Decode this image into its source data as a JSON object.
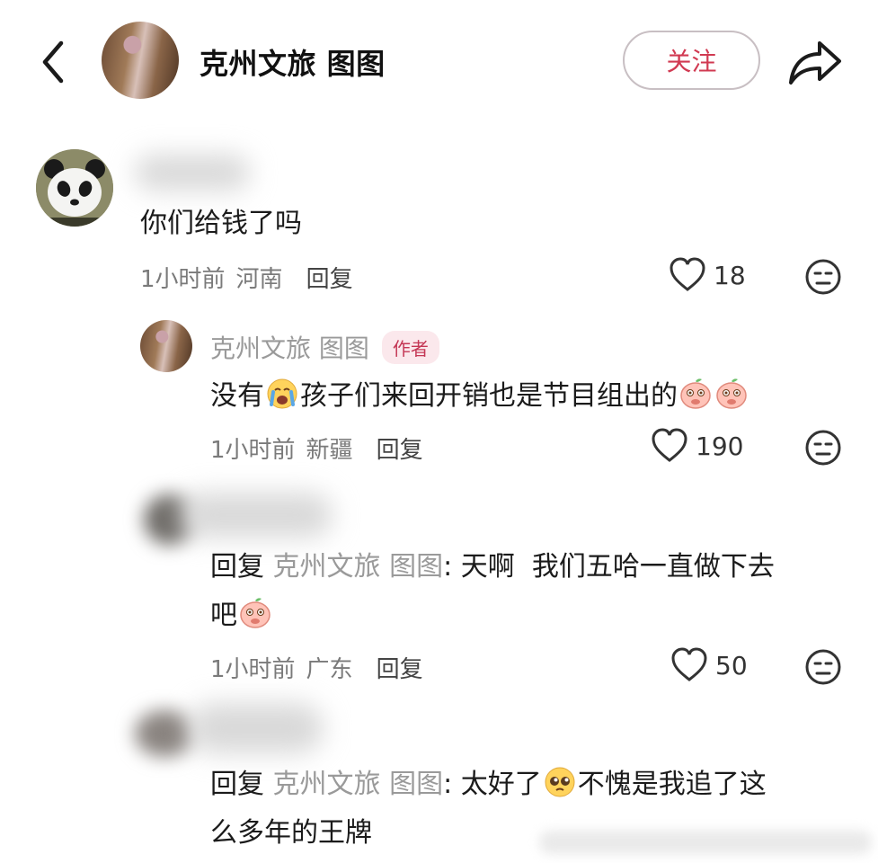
{
  "header": {
    "account_name": "克州文旅 图图",
    "follow_label": "关注"
  },
  "comments": [
    {
      "text": "你们给钱了吗",
      "time": "1小时前",
      "location": "河南",
      "reply_label": "回复",
      "likes": "18"
    }
  ],
  "author_reply": {
    "name": "克州文旅 图图",
    "badge": "作者",
    "text_part1": "没有",
    "text_part2": "孩子们来回开销也是节目组出的",
    "time": "1小时前",
    "location": "新疆",
    "reply_label": "回复",
    "likes": "190"
  },
  "reply_2": {
    "prefix": "回复",
    "mention": "克州文旅 图图",
    "colon": ":",
    "line1": "天啊  我们五哈一直做下去",
    "line2": "吧",
    "time": "1小时前",
    "location": "广东",
    "reply_label": "回复",
    "likes": "50"
  },
  "reply_3": {
    "prefix": "回复",
    "mention": "克州文旅 图图",
    "colon": ":",
    "line1_a": "太好了",
    "line1_b": "不愧是我追了这",
    "line2": "么多年的王牌"
  },
  "icons": {
    "back": "chevron-left-icon",
    "share": "share-arrow-icon",
    "like": "heart-outline-icon",
    "dislike": "neutral-face-icon"
  },
  "colors": {
    "accent": "#d13a52",
    "meta": "#7a7a7a",
    "mention": "#9a9a9a"
  }
}
